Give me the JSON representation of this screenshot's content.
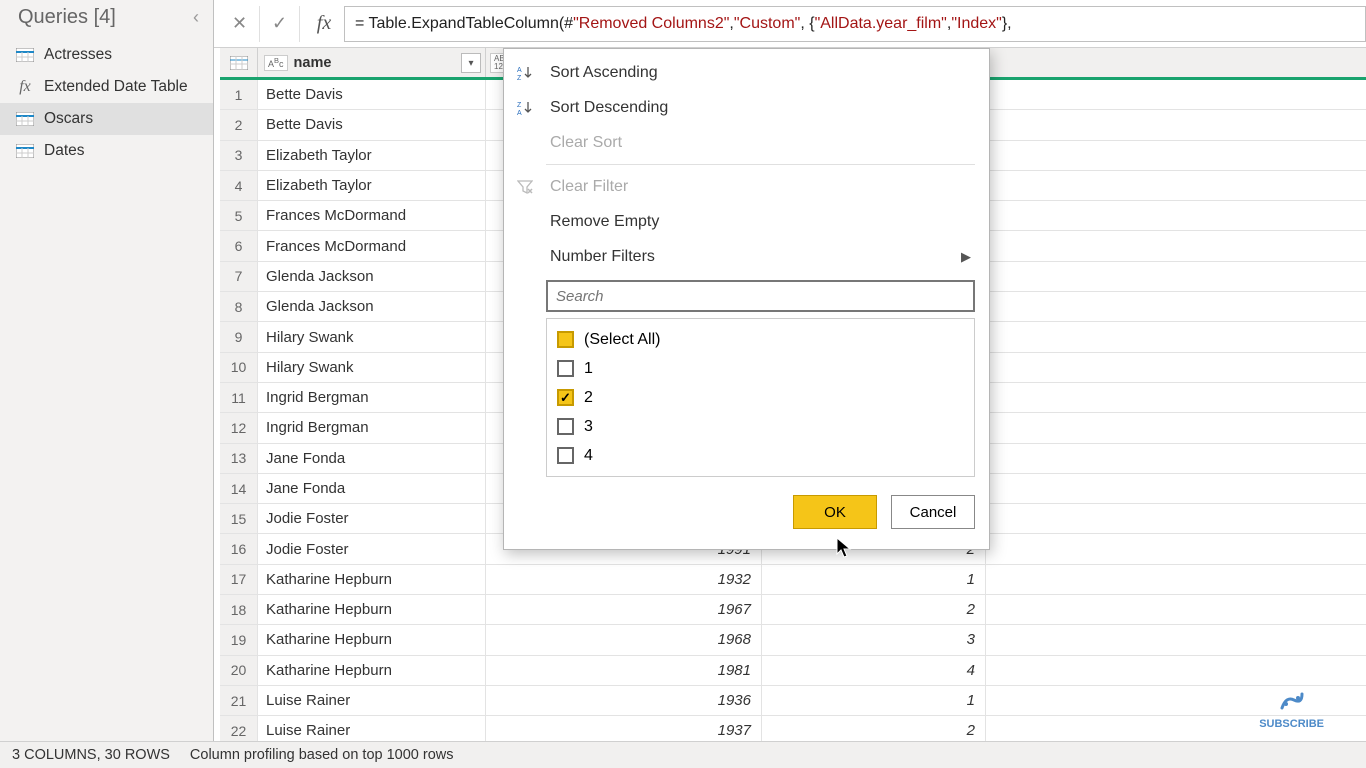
{
  "queries": {
    "title": "Queries [4]",
    "items": [
      {
        "label": "Actresses",
        "type": "table"
      },
      {
        "label": "Extended Date Table",
        "type": "fx"
      },
      {
        "label": "Oscars",
        "type": "table",
        "selected": true
      },
      {
        "label": "Dates",
        "type": "table"
      }
    ]
  },
  "formula": {
    "prefix": "= Table.ExpandTableColumn(#",
    "arg1": "\"Removed Columns2\"",
    "arg2": "\"Custom\"",
    "arg3a": "\"AllData.year_film\"",
    "arg3b": "\"Index\""
  },
  "columns": {
    "name_label": "name",
    "col2_type_top": "AB",
    "col2_type_bot": "12"
  },
  "rows": [
    {
      "n": "1",
      "name": "Bette Davis",
      "year": "",
      "idx": ""
    },
    {
      "n": "2",
      "name": "Bette Davis",
      "year": "",
      "idx": ""
    },
    {
      "n": "3",
      "name": "Elizabeth Taylor",
      "year": "",
      "idx": ""
    },
    {
      "n": "4",
      "name": "Elizabeth Taylor",
      "year": "",
      "idx": ""
    },
    {
      "n": "5",
      "name": "Frances McDormand",
      "year": "",
      "idx": ""
    },
    {
      "n": "6",
      "name": "Frances McDormand",
      "year": "",
      "idx": ""
    },
    {
      "n": "7",
      "name": "Glenda Jackson",
      "year": "",
      "idx": ""
    },
    {
      "n": "8",
      "name": "Glenda Jackson",
      "year": "",
      "idx": ""
    },
    {
      "n": "9",
      "name": "Hilary Swank",
      "year": "",
      "idx": ""
    },
    {
      "n": "10",
      "name": "Hilary Swank",
      "year": "",
      "idx": ""
    },
    {
      "n": "11",
      "name": "Ingrid Bergman",
      "year": "",
      "idx": ""
    },
    {
      "n": "12",
      "name": "Ingrid Bergman",
      "year": "",
      "idx": ""
    },
    {
      "n": "13",
      "name": "Jane Fonda",
      "year": "",
      "idx": ""
    },
    {
      "n": "14",
      "name": "Jane Fonda",
      "year": "",
      "idx": ""
    },
    {
      "n": "15",
      "name": "Jodie Foster",
      "year": "",
      "idx": ""
    },
    {
      "n": "16",
      "name": "Jodie Foster",
      "year": "1991",
      "idx": "2"
    },
    {
      "n": "17",
      "name": "Katharine Hepburn",
      "year": "1932",
      "idx": "1"
    },
    {
      "n": "18",
      "name": "Katharine Hepburn",
      "year": "1967",
      "idx": "2"
    },
    {
      "n": "19",
      "name": "Katharine Hepburn",
      "year": "1968",
      "idx": "3"
    },
    {
      "n": "20",
      "name": "Katharine Hepburn",
      "year": "1981",
      "idx": "4"
    },
    {
      "n": "21",
      "name": "Luise Rainer",
      "year": "1936",
      "idx": "1"
    },
    {
      "n": "22",
      "name": "Luise Rainer",
      "year": "1937",
      "idx": "2"
    }
  ],
  "popup": {
    "sort_asc": "Sort Ascending",
    "sort_desc": "Sort Descending",
    "clear_sort": "Clear Sort",
    "clear_filter": "Clear Filter",
    "remove_empty": "Remove Empty",
    "number_filters": "Number Filters",
    "search_placeholder": "Search",
    "select_all": "(Select All)",
    "values": [
      "1",
      "2",
      "3",
      "4"
    ],
    "checked_index": 1,
    "ok": "OK",
    "cancel": "Cancel"
  },
  "status": {
    "cols_rows": "3 COLUMNS, 30 ROWS",
    "profiling": "Column profiling based on top 1000 rows"
  },
  "subscribe": "SUBSCRIBE"
}
